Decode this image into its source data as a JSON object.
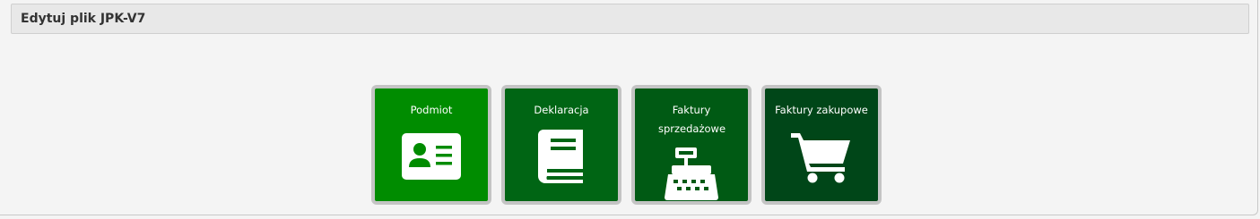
{
  "header": {
    "title": "Edytuj plik JPK-V7"
  },
  "tiles": [
    {
      "label": "Podmiot",
      "icon": "id-card-icon",
      "color": "#008c00"
    },
    {
      "label": "Deklaracja",
      "icon": "book-icon",
      "color": "#006514"
    },
    {
      "label": "Faktury sprzedażowe",
      "icon": "cash-register-icon",
      "color": "#005a14"
    },
    {
      "label": "Faktury zakupowe",
      "icon": "shopping-cart-icon",
      "color": "#004618"
    }
  ]
}
